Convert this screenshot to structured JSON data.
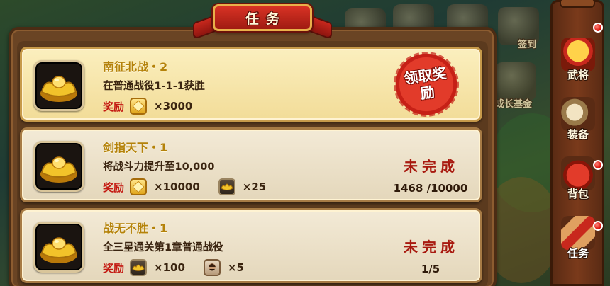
{
  "panel": {
    "title": "任务"
  },
  "background": {
    "labels": [
      "签到",
      "成长基金"
    ]
  },
  "quests": [
    {
      "name": "南征北战・2",
      "description": "在普通战役1-1-1获胜",
      "reward_label": "奖励",
      "rewards": [
        {
          "icon": "gold-coin-icon",
          "qty": "×3000"
        }
      ],
      "state": "claimable",
      "claim_label": "领取奖励"
    },
    {
      "name": "剑指天下・1",
      "description": "将战斗力提升至10,000",
      "reward_label": "奖励",
      "rewards": [
        {
          "icon": "gold-coin-icon",
          "qty": "×10000"
        },
        {
          "icon": "gold-ingot-icon",
          "qty": "×25"
        }
      ],
      "state": "incomplete",
      "status": "未完成",
      "progress": "1468 /10000"
    },
    {
      "name": "战无不胜・1",
      "description": "全三星通关第1章普通战役",
      "reward_label": "奖励",
      "rewards": [
        {
          "icon": "gold-ingot-icon",
          "qty": "×100"
        },
        {
          "icon": "general-portrait-icon",
          "qty": "×5"
        }
      ],
      "state": "incomplete",
      "status": "未完成",
      "progress": "1/5"
    }
  ],
  "sidebar": {
    "items": [
      {
        "label": "武将",
        "icon": "general-helmet-icon",
        "badge": true
      },
      {
        "label": "装备",
        "icon": "equipment-icon",
        "badge": false
      },
      {
        "label": "背包",
        "icon": "bag-icon",
        "badge": true
      },
      {
        "label": "任务",
        "icon": "scroll-icon",
        "badge": true,
        "active": true
      }
    ]
  },
  "colors": {
    "reward_red": "#c41a12",
    "quest_name_gold": "#b4820a",
    "status_red": "#a8190f",
    "title_red": "#d83224"
  }
}
